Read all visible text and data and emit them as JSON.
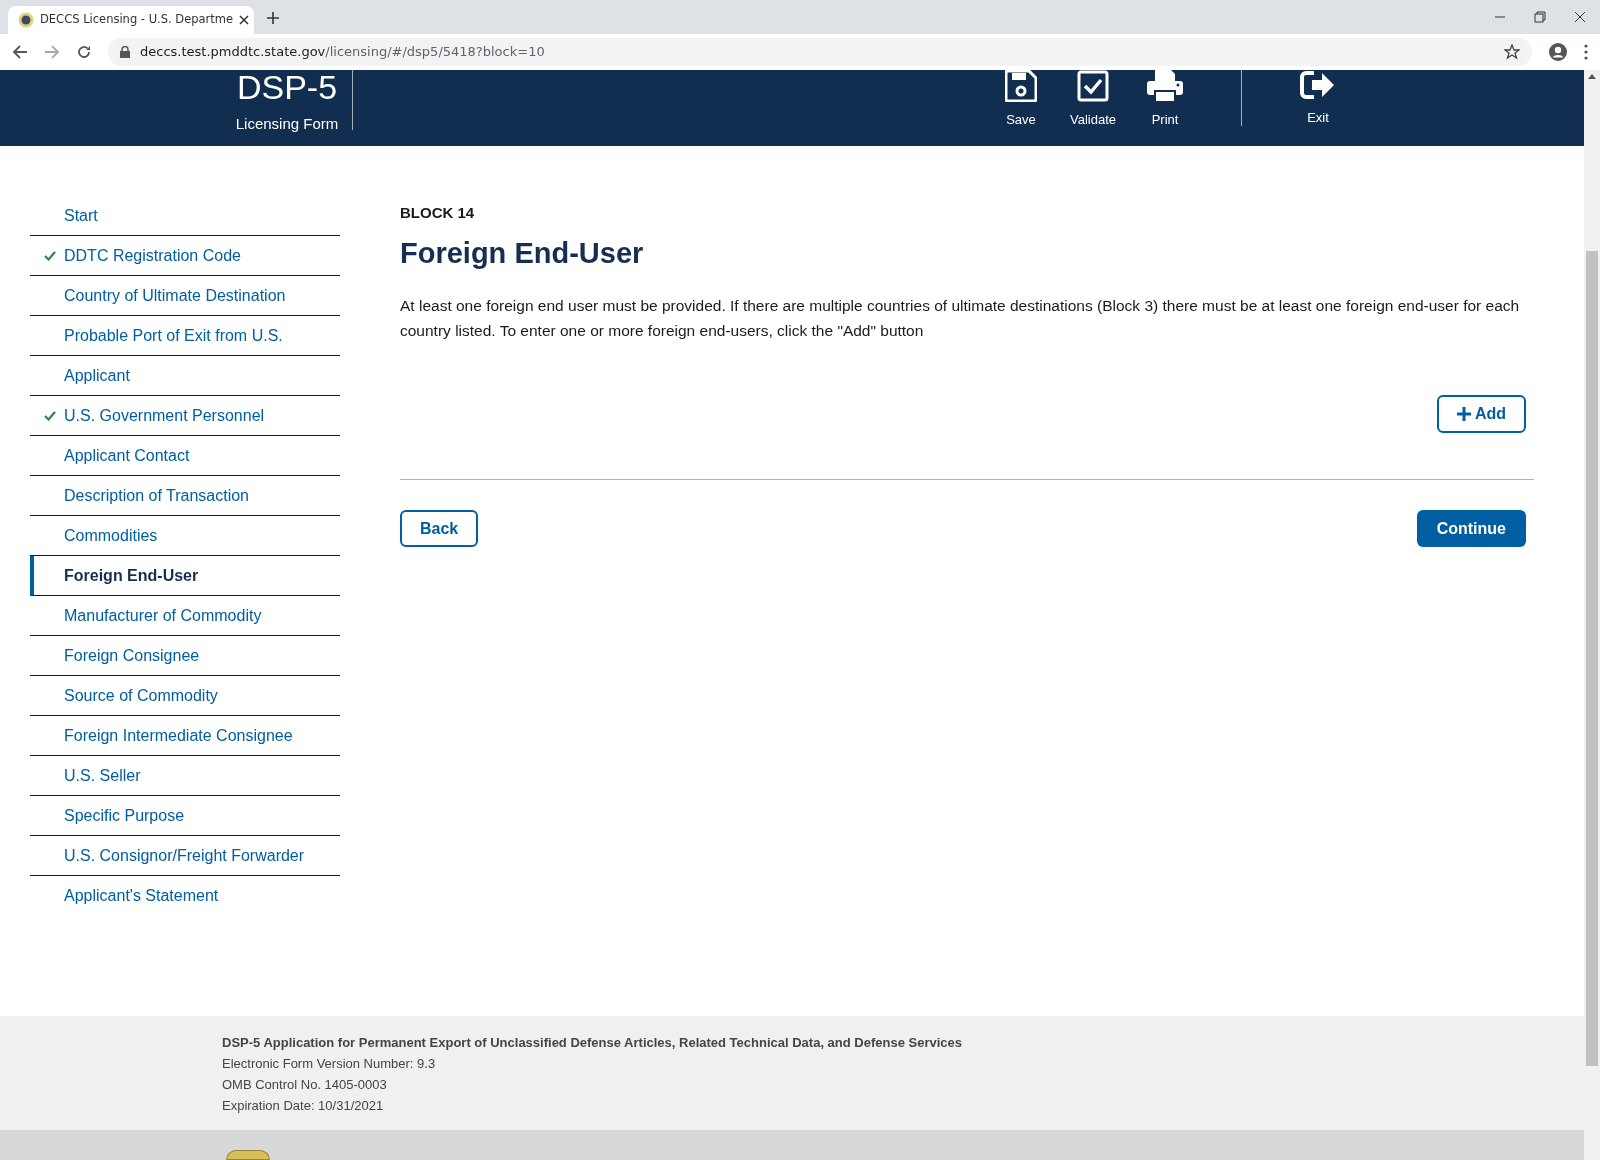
{
  "browser": {
    "tab_title": "DECCS Licensing - U.S. Departme",
    "url_host": "deccs.test.pmddtc.state.gov",
    "url_path": "/licensing/#/dsp5/5418?block=10"
  },
  "header": {
    "title": "DSP-5",
    "subtitle": "Licensing Form",
    "actions": [
      {
        "kind": "save",
        "label": "Save"
      },
      {
        "kind": "validate",
        "label": "Validate"
      },
      {
        "kind": "print",
        "label": "Print"
      },
      {
        "kind": "exit",
        "label": "Exit"
      }
    ]
  },
  "sidebar": {
    "items": [
      {
        "label": "Start",
        "checked": false,
        "selected": false
      },
      {
        "label": "DDTC Registration Code",
        "checked": true,
        "selected": false
      },
      {
        "label": "Country of Ultimate Destination",
        "checked": false,
        "selected": false
      },
      {
        "label": "Probable Port of Exit from U.S.",
        "checked": false,
        "selected": false
      },
      {
        "label": "Applicant",
        "checked": false,
        "selected": false
      },
      {
        "label": "U.S. Government Personnel",
        "checked": true,
        "selected": false
      },
      {
        "label": "Applicant Contact",
        "checked": false,
        "selected": false
      },
      {
        "label": "Description of Transaction",
        "checked": false,
        "selected": false
      },
      {
        "label": "Commodities",
        "checked": false,
        "selected": false
      },
      {
        "label": "Foreign End-User",
        "checked": false,
        "selected": true
      },
      {
        "label": "Manufacturer of Commodity",
        "checked": false,
        "selected": false
      },
      {
        "label": "Foreign Consignee",
        "checked": false,
        "selected": false
      },
      {
        "label": "Source of Commodity",
        "checked": false,
        "selected": false
      },
      {
        "label": "Foreign Intermediate Consignee",
        "checked": false,
        "selected": false
      },
      {
        "label": "U.S. Seller",
        "checked": false,
        "selected": false
      },
      {
        "label": "Specific Purpose",
        "checked": false,
        "selected": false
      },
      {
        "label": "U.S. Consignor/Freight Forwarder",
        "checked": false,
        "selected": false
      },
      {
        "label": "Applicant's Statement",
        "checked": false,
        "selected": false
      }
    ]
  },
  "main": {
    "block": "BLOCK 14",
    "heading": "Foreign End-User",
    "description": "At least one foreign end user must be provided. If there are multiple countries of ultimate destinations (Block 3) there must be at least one foreign end-user for each country listed. To enter one or more foreign end-users, click the \"Add\" button",
    "add_button": "Add",
    "back_button": "Back",
    "continue_button": "Continue"
  },
  "footer": {
    "title": "DSP-5 Application for Permanent Export of Unclassified Defense Articles, Related Technical Data, and Defense Services",
    "lines": [
      "Electronic Form Version Number: 9.3",
      "OMB Control No. 1405-0003",
      "Expiration Date: 10/31/2021"
    ]
  }
}
